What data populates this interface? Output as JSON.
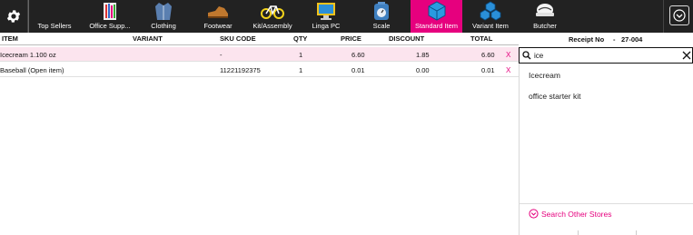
{
  "toolbar": {
    "categories": [
      {
        "label": "Top Sellers",
        "icon": "top-sellers-icon"
      },
      {
        "label": "Office Supp...",
        "icon": "office-supplies-icon"
      },
      {
        "label": "Clothing",
        "icon": "clothing-icon"
      },
      {
        "label": "Footwear",
        "icon": "footwear-icon"
      },
      {
        "label": "Kit/Assembly",
        "icon": "bicycle-icon"
      },
      {
        "label": "Linga PC",
        "icon": "monitor-icon"
      },
      {
        "label": "Scale",
        "icon": "scale-icon"
      },
      {
        "label": "Standard Item",
        "icon": "cube-icon",
        "active": true
      },
      {
        "label": "Variant Item",
        "icon": "cubes-icon"
      },
      {
        "label": "Butcher",
        "icon": "butcher-icon"
      }
    ],
    "active_color": "#e6007e"
  },
  "table": {
    "headers": {
      "item": "ITEM",
      "variant": "VARIANT",
      "sku": "SKU CODE",
      "qty": "QTY",
      "price": "PRICE",
      "discount": "DISCOUNT",
      "total": "TOTAL"
    },
    "rows": [
      {
        "item": "Icecream 1.100 oz",
        "variant": "",
        "sku": "-",
        "qty": "1",
        "price": "6.60",
        "discount": "1.85",
        "total": "6.60",
        "remove": "X"
      },
      {
        "item": "Baseball (Open item)",
        "variant": "",
        "sku": "11221192375",
        "qty": "1",
        "price": "0.01",
        "discount": "0.00",
        "total": "0.01",
        "remove": "X"
      }
    ]
  },
  "receipt": {
    "label": "Receipt No",
    "dash": "-",
    "number": "27-004"
  },
  "search": {
    "value": "ice",
    "placeholder": ""
  },
  "suggestions": [
    "Icecream",
    "office starter kit"
  ],
  "other_stores": {
    "label": "Search Other Stores"
  }
}
